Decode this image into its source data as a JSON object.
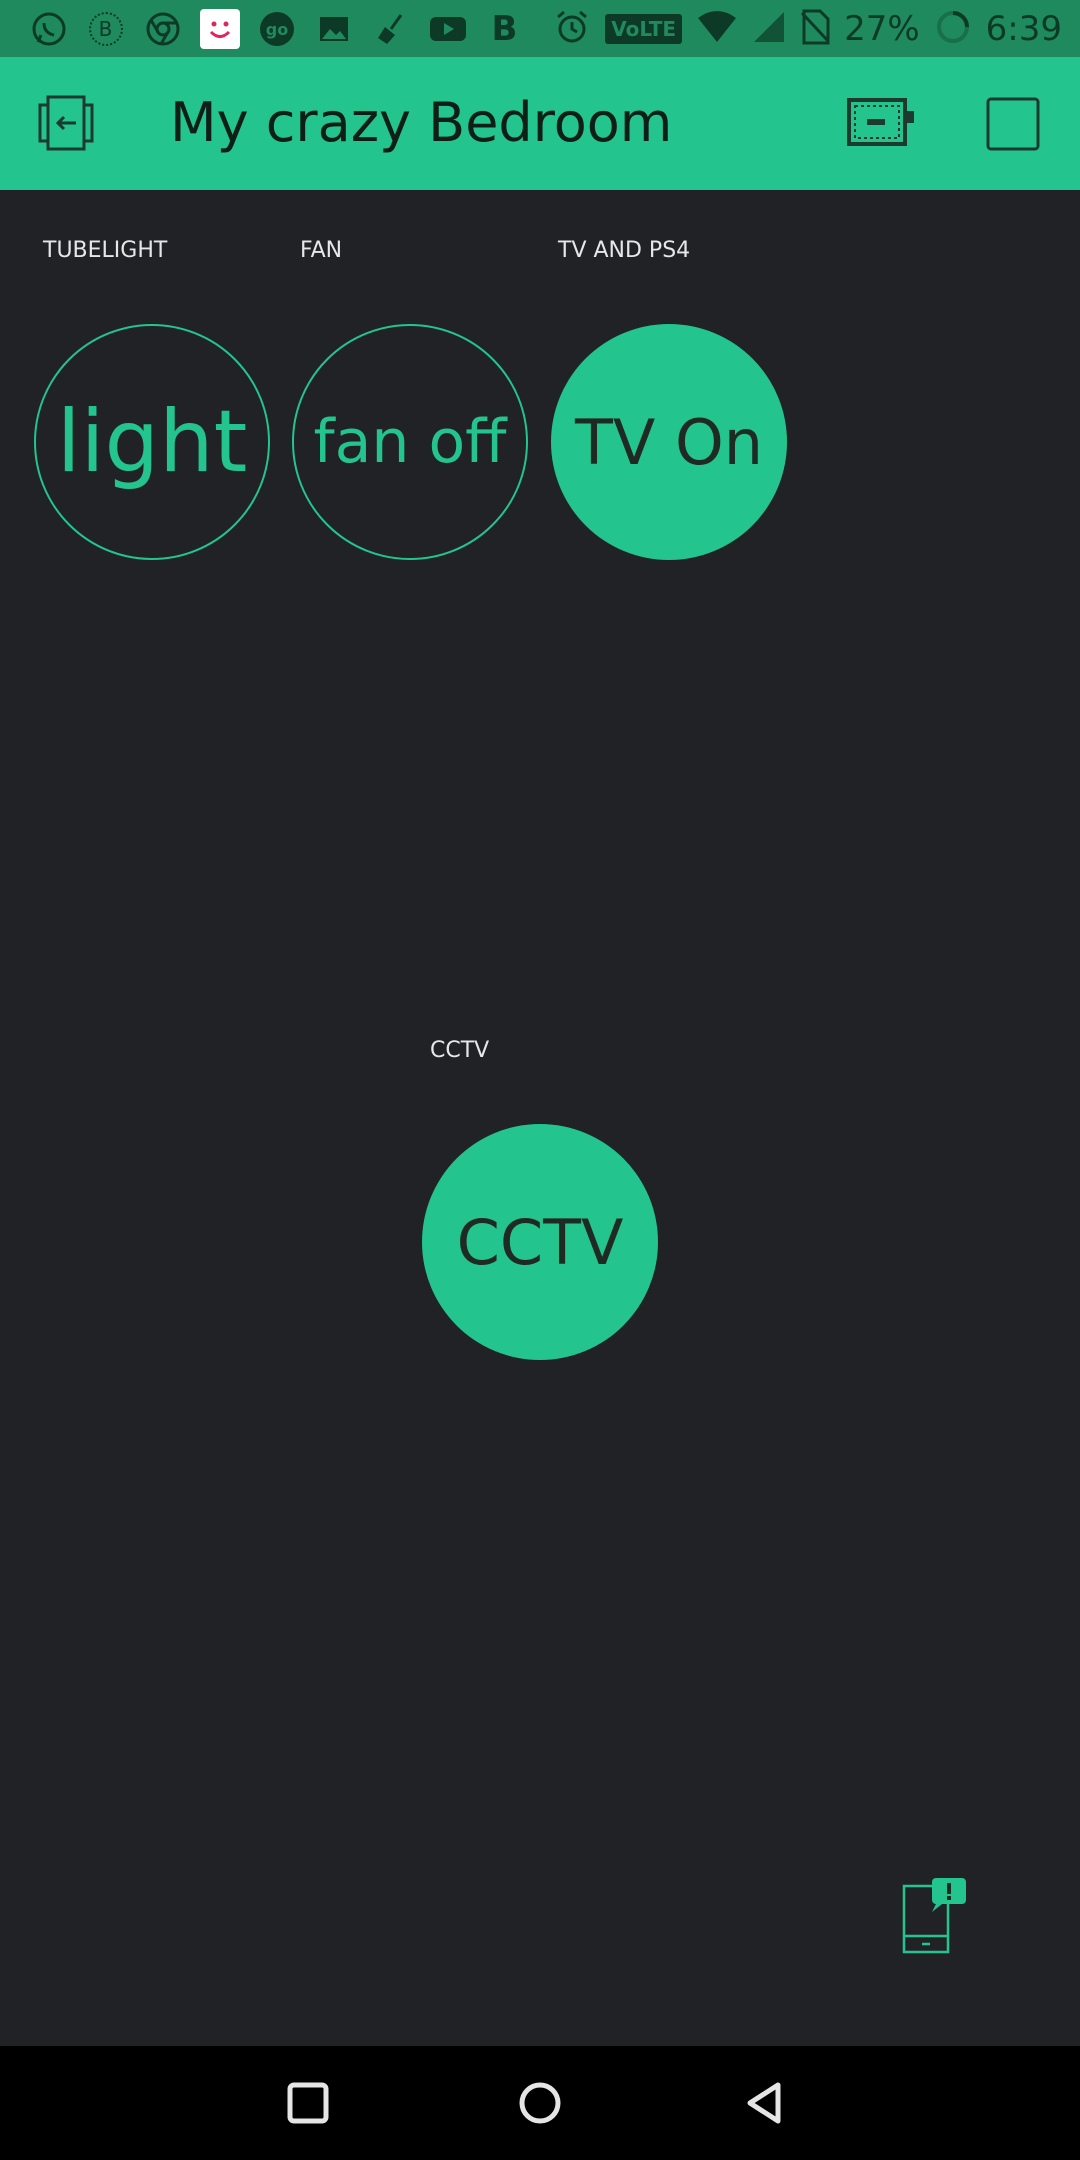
{
  "status_bar": {
    "notification_icons": [
      "whatsapp-icon",
      "b-icon",
      "chrome-icon",
      "face-app-icon",
      "go-icon",
      "gallery-icon",
      "broom-icon",
      "youtube-icon",
      "b-bold-icon"
    ],
    "volte": "VoLTE",
    "battery_percent": "27%",
    "time": "6:39"
  },
  "app_bar": {
    "title": "My crazy Bedroom",
    "background_color": "#23c48e"
  },
  "widgets": [
    {
      "label": "TUBELIGHT",
      "button_text": "light",
      "state": "off"
    },
    {
      "label": "FAN",
      "button_text": "fan off",
      "state": "off"
    },
    {
      "label": "TV AND PS4",
      "button_text": "TV On",
      "state": "on"
    },
    {
      "label": "CCTV",
      "button_text": "CCTV",
      "state": "on"
    }
  ],
  "colors": {
    "accent": "#23c48e",
    "background": "#212226",
    "status_bar": "#1f8a5e"
  }
}
